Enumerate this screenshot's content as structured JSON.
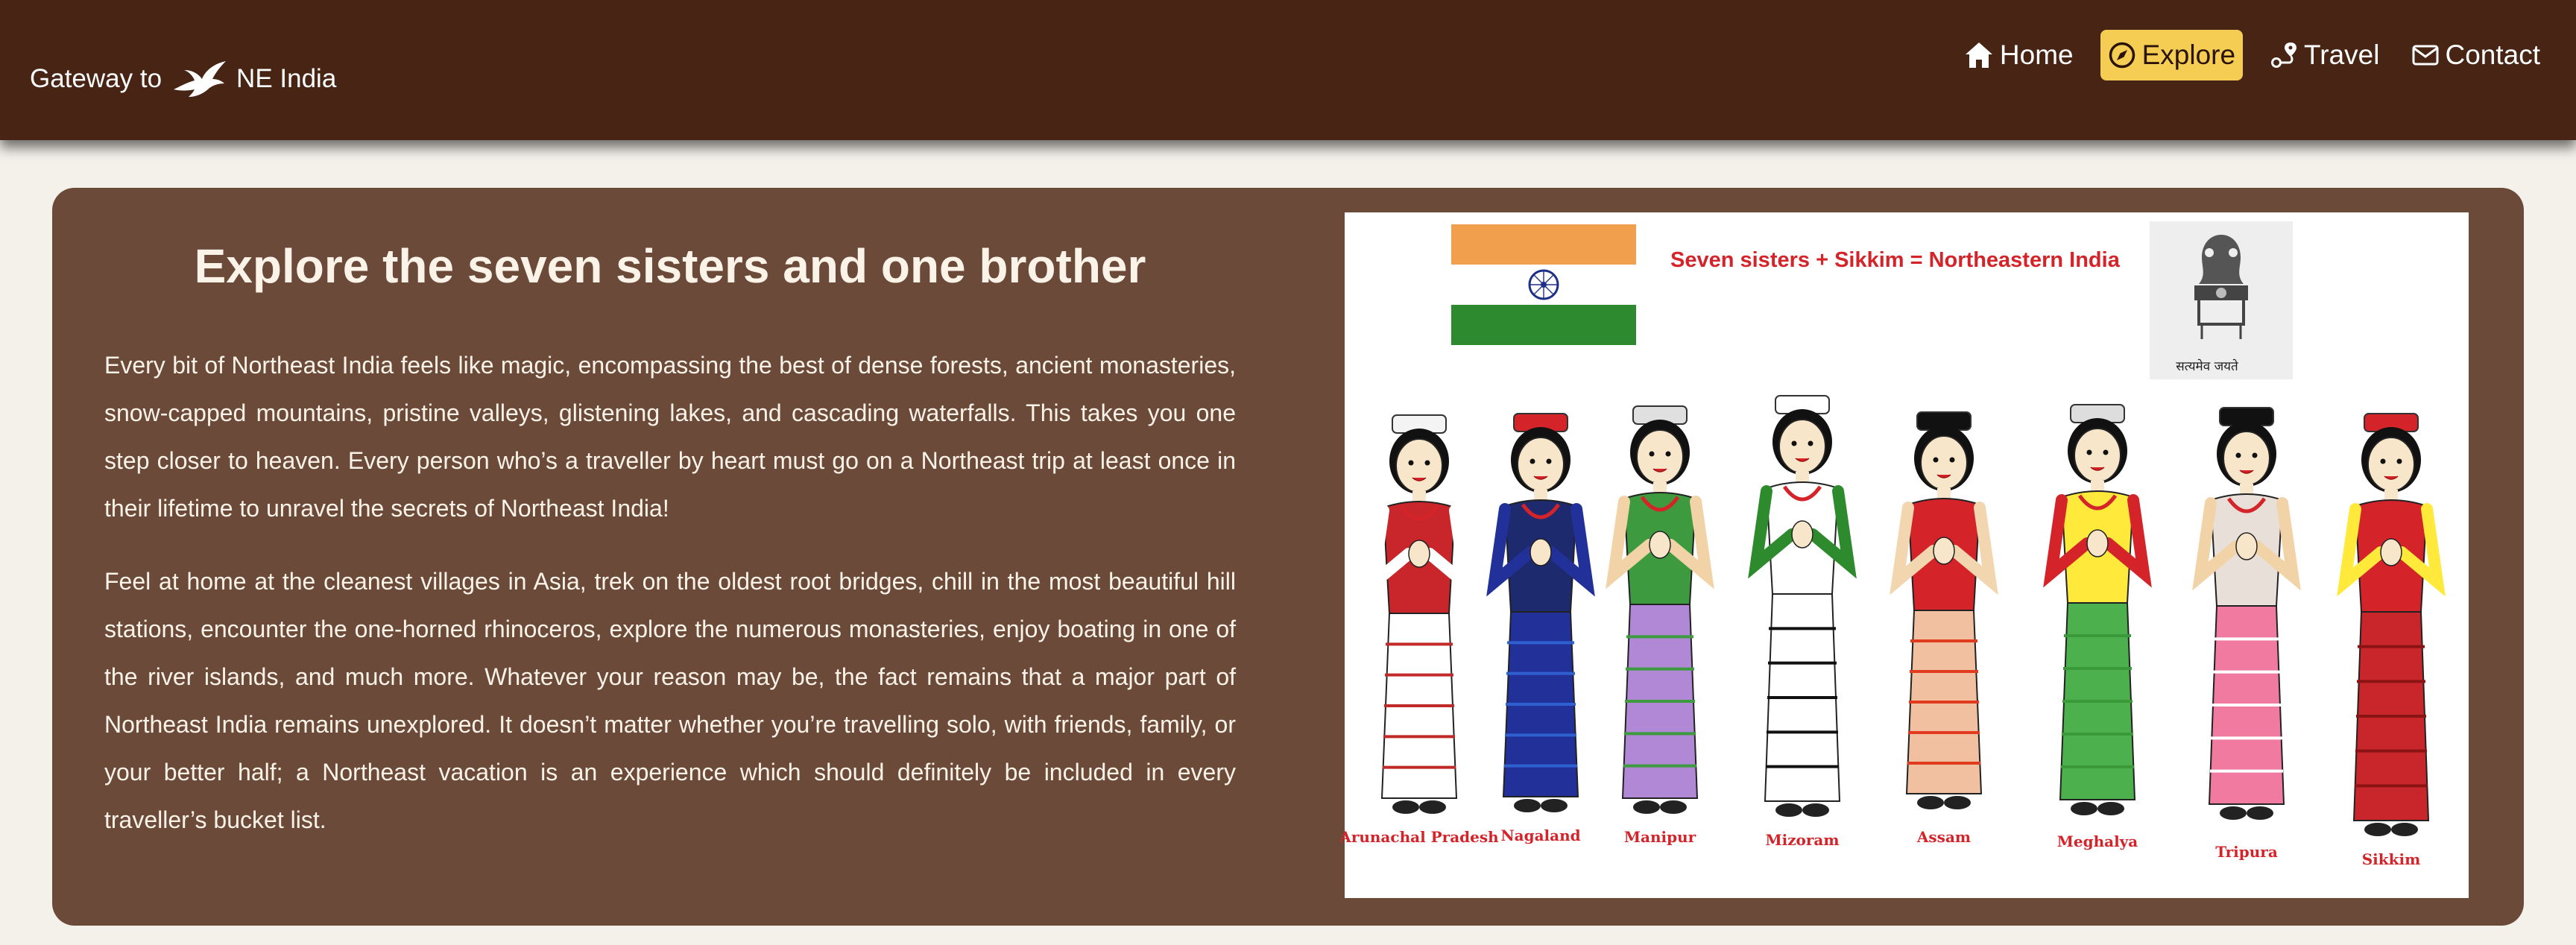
{
  "brand": {
    "text_before": "Gateway to",
    "text_after": "NE India",
    "logo_icon": "flying-bird-icon"
  },
  "nav": {
    "items": [
      {
        "label": "Home",
        "icon": "home-icon",
        "active": false
      },
      {
        "label": "Explore",
        "icon": "compass-icon",
        "active": true
      },
      {
        "label": "Travel",
        "icon": "route-icon",
        "active": false
      },
      {
        "label": "Contact",
        "icon": "envelope-icon",
        "active": false
      }
    ]
  },
  "colors": {
    "navbar": "#472413",
    "card": "#6b4a3a",
    "active_nav": "#f5cd52",
    "page_bg": "#f4f0ea",
    "label_red": "#d5232a"
  },
  "main": {
    "headline": "Explore the seven sisters and one brother",
    "paragraphs": [
      "Every bit of Northeast India feels like magic, encompassing the best of dense forests, ancient monasteries, snow-capped mountains, pristine valleys, glistening lakes, and cascading waterfalls. This takes you one step closer to heaven. Every person who’s a traveller by heart must go on a Northeast trip at least once in their lifetime to unravel the secrets of Northeast India!",
      "Feel at home at the cleanest villages in Asia, trek on the oldest root bridges, chill in the most beautiful hill stations, encounter the one-horned rhinoceros, explore the numerous monasteries, enjoy boating in one of the river islands, and much more. Whatever your reason may be, the fact remains that a major part of Northeast India remains unexplored. It doesn’t matter whether you’re travelling solo, with friends, family, or your better half; a Northeast vacation is an experience which should definitely be included in every traveller’s bucket list."
    ]
  },
  "illustration": {
    "caption": "Seven sisters + Sikkim = Northeastern India",
    "emblem_motto": "सत्यमेव जयते",
    "states": [
      "Arunachal Pradesh",
      "Nagaland",
      "Manipur",
      "Mizoram",
      "Assam",
      "Meghalya",
      "Tripura",
      "Sikkim"
    ]
  }
}
